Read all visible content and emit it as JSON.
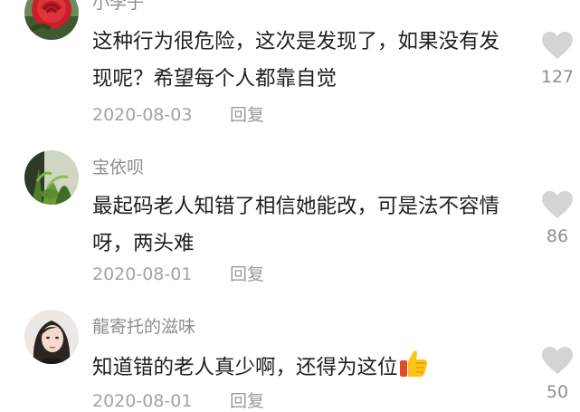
{
  "comments": [
    {
      "username": "小李子",
      "text": "这种行为很危险，这次是发现了，如果没有发现呢？希望每个人都靠自觉",
      "date": "2020-08-03",
      "reply_label": "回复",
      "likes": "127",
      "avatar_icon": "red-rose-avatar"
    },
    {
      "username": "宝依呗",
      "text": "最起码老人知错了相信她能改，可是法不容情呀，两头难",
      "date": "2020-08-01",
      "reply_label": "回复",
      "likes": "86",
      "avatar_icon": "green-plant-avatar"
    },
    {
      "username": "龍寄托的滋味",
      "text": "知道错的老人真少啊，还得为这位",
      "emoji": "thumbs-up-icon",
      "date": "2020-08-01",
      "reply_label": "回复",
      "likes": "50",
      "avatar_icon": "woman-portrait-avatar"
    }
  ],
  "colors": {
    "username": "#8d8d8d",
    "text": "#1f1f1f",
    "meta": "#a3a3a3",
    "heart": "#d4d4d4"
  }
}
